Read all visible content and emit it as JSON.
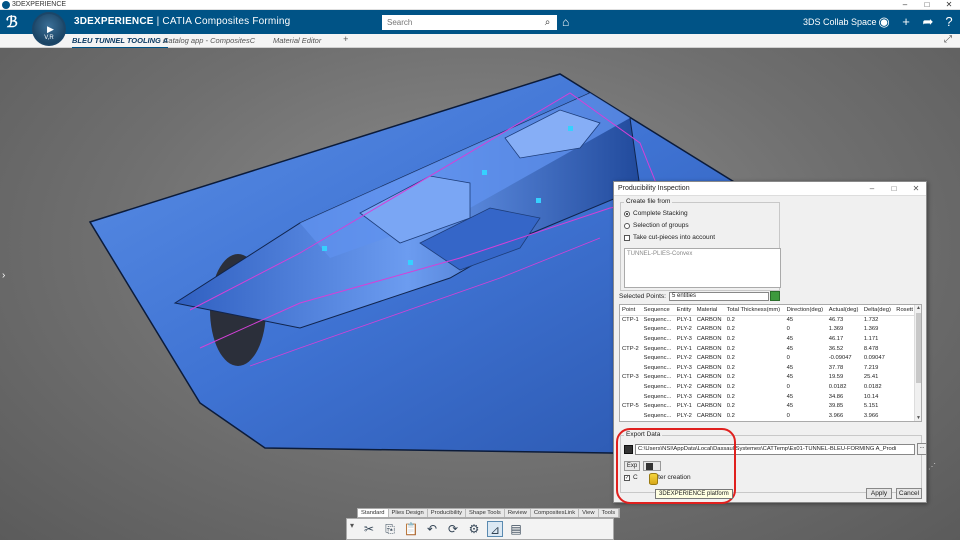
{
  "window": {
    "title": "3DEXPERIENCE"
  },
  "appbar": {
    "brand_bold": "3DEXPERIENCE",
    "brand_rest": " | CATIA  Composites Forming",
    "search_placeholder": "Search",
    "collab_space": "3DS Collab Space",
    "compass_version": "V,R"
  },
  "tabs": [
    {
      "label": "BLEU TUNNEL TOOLING A"
    },
    {
      "label": "Catalog app - CompositesC"
    },
    {
      "label": "Material Editor"
    },
    {
      "label": "+"
    }
  ],
  "dialog": {
    "title": "Producibility Inspection",
    "create_legend": "Create file from",
    "opt_complete": "Complete Stacking",
    "opt_groups": "Selection of groups",
    "opt_cut": "Take cut-pieces into account",
    "group_list_item": "TUNNEL-PLIES-Convex",
    "selected_points_label": "Selected Points:",
    "selected_points_value": "5 entities",
    "columns": [
      "Point",
      "Sequence",
      "Entity",
      "Material",
      "Total Thickness(mm)",
      "Direction(deg)",
      "Actual(deg)",
      "Delta(deg)",
      "Rosett"
    ],
    "rows": [
      [
        "CTP-1",
        "Sequenc...",
        "PLY-1",
        "CARBON",
        "0.2",
        "45",
        "46.73",
        "1.732",
        ""
      ],
      [
        "",
        "Sequenc...",
        "PLY-2",
        "CARBON",
        "0.2",
        "0",
        "1.369",
        "1.369",
        ""
      ],
      [
        "",
        "Sequenc...",
        "PLY-3",
        "CARBON",
        "0.2",
        "45",
        "46.17",
        "1.171",
        ""
      ],
      [
        "CTP-2",
        "Sequenc...",
        "PLY-1",
        "CARBON",
        "0.2",
        "45",
        "36.52",
        "8.478",
        ""
      ],
      [
        "",
        "Sequenc...",
        "PLY-2",
        "CARBON",
        "0.2",
        "0",
        "-0.09047",
        "0.09047",
        ""
      ],
      [
        "",
        "Sequenc...",
        "PLY-3",
        "CARBON",
        "0.2",
        "45",
        "37.78",
        "7.219",
        ""
      ],
      [
        "CTP-3",
        "Sequenc...",
        "PLY-1",
        "CARBON",
        "0.2",
        "45",
        "19.59",
        "25.41",
        ""
      ],
      [
        "",
        "Sequenc...",
        "PLY-2",
        "CARBON",
        "0.2",
        "0",
        "0.0182",
        "0.0182",
        ""
      ],
      [
        "",
        "Sequenc...",
        "PLY-3",
        "CARBON",
        "0.2",
        "45",
        "34.86",
        "10.14",
        ""
      ],
      [
        "CTP-5",
        "Sequenc...",
        "PLY-1",
        "CARBON",
        "0.2",
        "45",
        "39.85",
        "5.151",
        ""
      ],
      [
        "",
        "Sequenc...",
        "PLY-2",
        "CARBON",
        "0.2",
        "0",
        "3.966",
        "3.966",
        ""
      ]
    ],
    "export_legend": "Export Data",
    "export_path": "C:\\Users\\NSI\\AppData\\Local\\DassaultSystemes\\CATTemp\\Ex01-TUNNEL-BLEU-FORMING A_Prodi",
    "dots": "...",
    "exp_label": "Exp",
    "open_after_prefix": "C",
    "open_after_suffix": "after creation",
    "tooltip": "3DEXPERIENCE platform",
    "apply": "Apply",
    "cancel": "Cancel"
  },
  "toolbar_tabs": [
    "Standard",
    "Plies Design",
    "Producibility",
    "Shape Tools",
    "Review",
    "CompositesLink",
    "View",
    "Tools"
  ],
  "toolbar_active": "Standard",
  "toolbar_icons": [
    "scissors-icon",
    "copy-icon",
    "paste-icon",
    "undo-icon",
    "update-icon",
    "settings-icon",
    "measure-icon",
    "graph-icon"
  ],
  "colors": {
    "brand": "#005386",
    "part": "#3f78d8",
    "highlight": "#e0201e",
    "edge": "#d440d8"
  }
}
